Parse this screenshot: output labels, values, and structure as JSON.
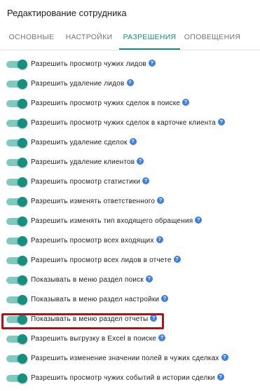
{
  "header": {
    "title": "Редактирование сотрудника"
  },
  "tabs": [
    {
      "label": "ОСНОВНЫЕ",
      "active": false
    },
    {
      "label": "НАСТРОЙКИ",
      "active": false
    },
    {
      "label": "РАЗРЕШЕНИЯ",
      "active": true
    },
    {
      "label": "ОПОВЕЩЕНИЯ",
      "active": false
    }
  ],
  "permissions": [
    {
      "label": "Разрешить просмотр чужих лидов",
      "enabled": true,
      "help_icon": "question-icon"
    },
    {
      "label": "Разрешить удаление лидов",
      "enabled": true,
      "help_icon": "question-icon"
    },
    {
      "label": "Разрешить просмотр чужих сделок в поиске",
      "enabled": true,
      "help_icon": "question-icon"
    },
    {
      "label": "Разрешить просмотр чужих сделок в карточке клиента",
      "enabled": true,
      "help_icon": "question-icon"
    },
    {
      "label": "Разрешить удаление сделок",
      "enabled": true,
      "help_icon": "question-icon"
    },
    {
      "label": "Разрешить удаление клиентов",
      "enabled": true,
      "help_icon": "question-icon"
    },
    {
      "label": "Разрешить просмотр статистики",
      "enabled": true,
      "help_icon": "question-icon"
    },
    {
      "label": "Разрешить изменять ответственного",
      "enabled": true,
      "help_icon": "question-icon"
    },
    {
      "label": "Разрешить изменять тип входящего обращения",
      "enabled": true,
      "help_icon": "question-icon"
    },
    {
      "label": "Разрешить просмотр всех входящих",
      "enabled": true,
      "help_icon": "question-icon"
    },
    {
      "label": "Разрешить просмотр всех лидов в отчете",
      "enabled": true,
      "help_icon": "question-icon"
    },
    {
      "label": "Показывать в меню раздел поиск",
      "enabled": true,
      "help_icon": "question-icon"
    },
    {
      "label": "Показывать в меню раздел настройки",
      "enabled": true,
      "help_icon": "question-icon"
    },
    {
      "label": "Показывать в меню раздел отчеты",
      "enabled": true,
      "help_icon": "question-icon",
      "highlighted": true
    },
    {
      "label": "Разрешить выгрузку в Excel в поиске",
      "enabled": true,
      "help_icon": "question-icon"
    },
    {
      "label": "Разрешить изменение значении полей в чужих сделках",
      "enabled": true,
      "help_icon": "question-icon"
    },
    {
      "label": "Разрешить просмотр чужих событий в истории сделки",
      "enabled": true,
      "help_icon": "question-icon"
    }
  ],
  "help_glyph": "?",
  "colors": {
    "accent": "#11907f",
    "toggle_track": "#7ecbbd",
    "help_icon": "#3d7fe0",
    "highlight_border": "#b0121b"
  }
}
